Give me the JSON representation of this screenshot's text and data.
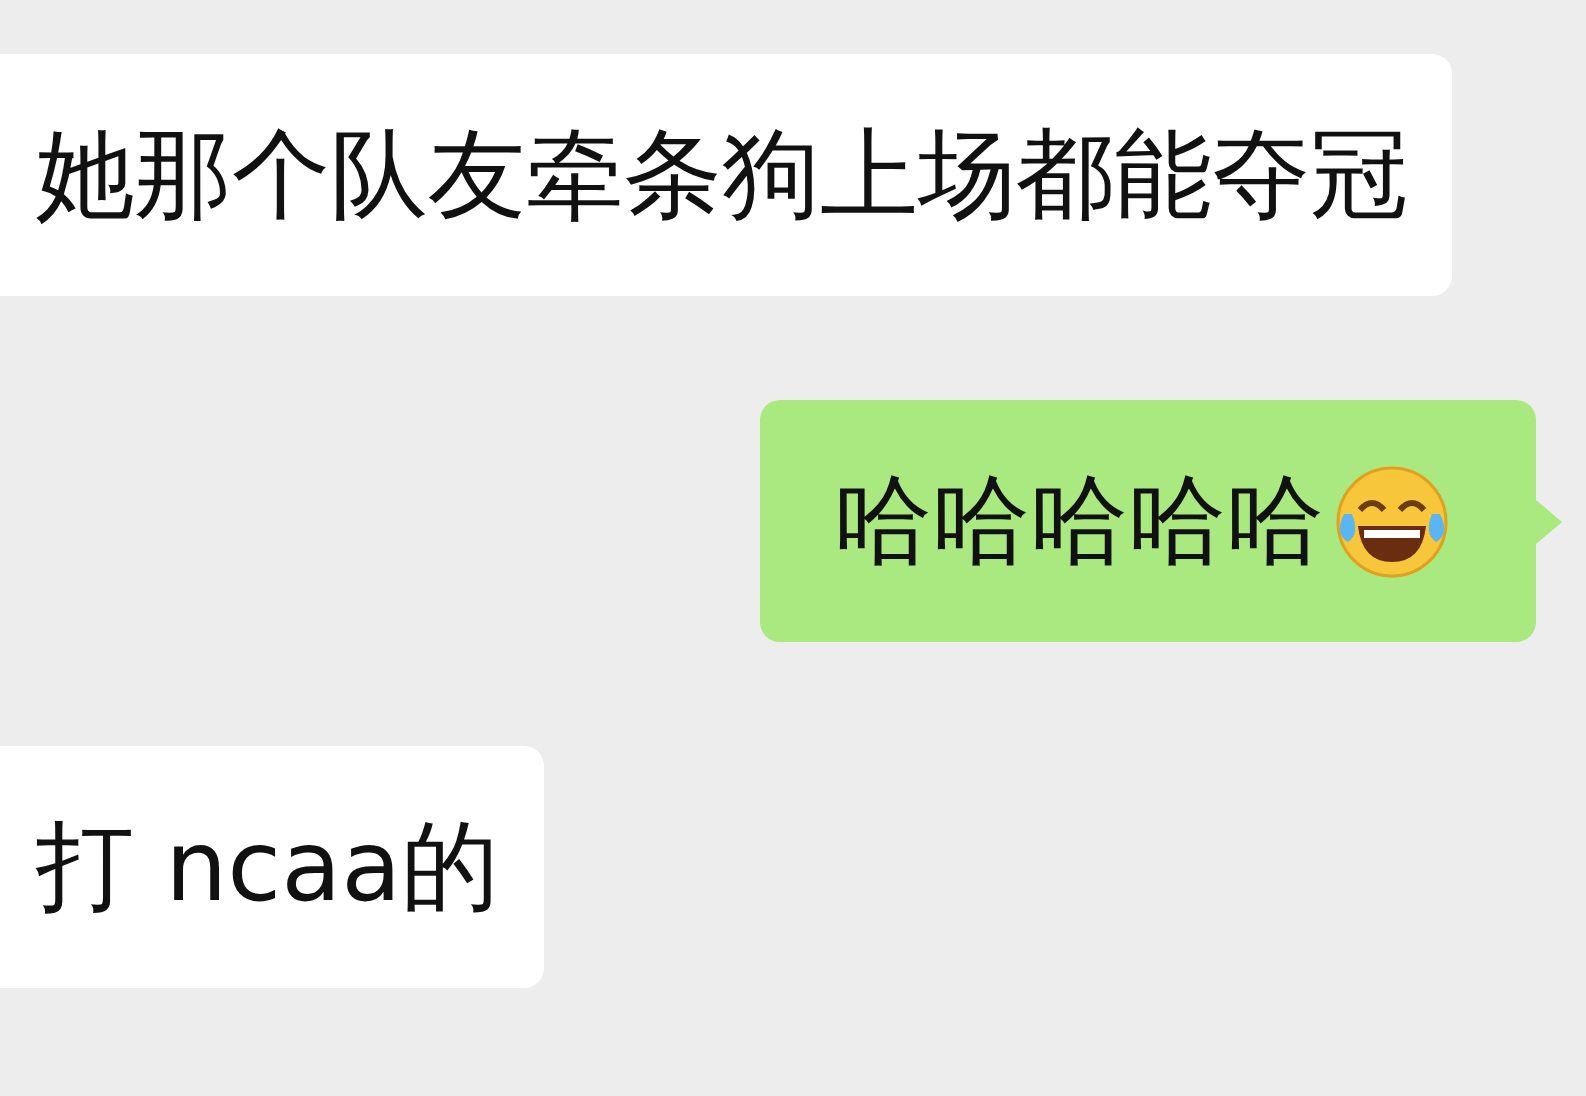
{
  "messages": [
    {
      "outgoing": false,
      "text": "她那个队友牵条狗上场都能夺冠",
      "emoji": false
    },
    {
      "outgoing": true,
      "text": "哈哈哈哈哈",
      "emoji": true
    },
    {
      "outgoing": false,
      "text": "打 ncaa的",
      "emoji": false
    }
  ]
}
